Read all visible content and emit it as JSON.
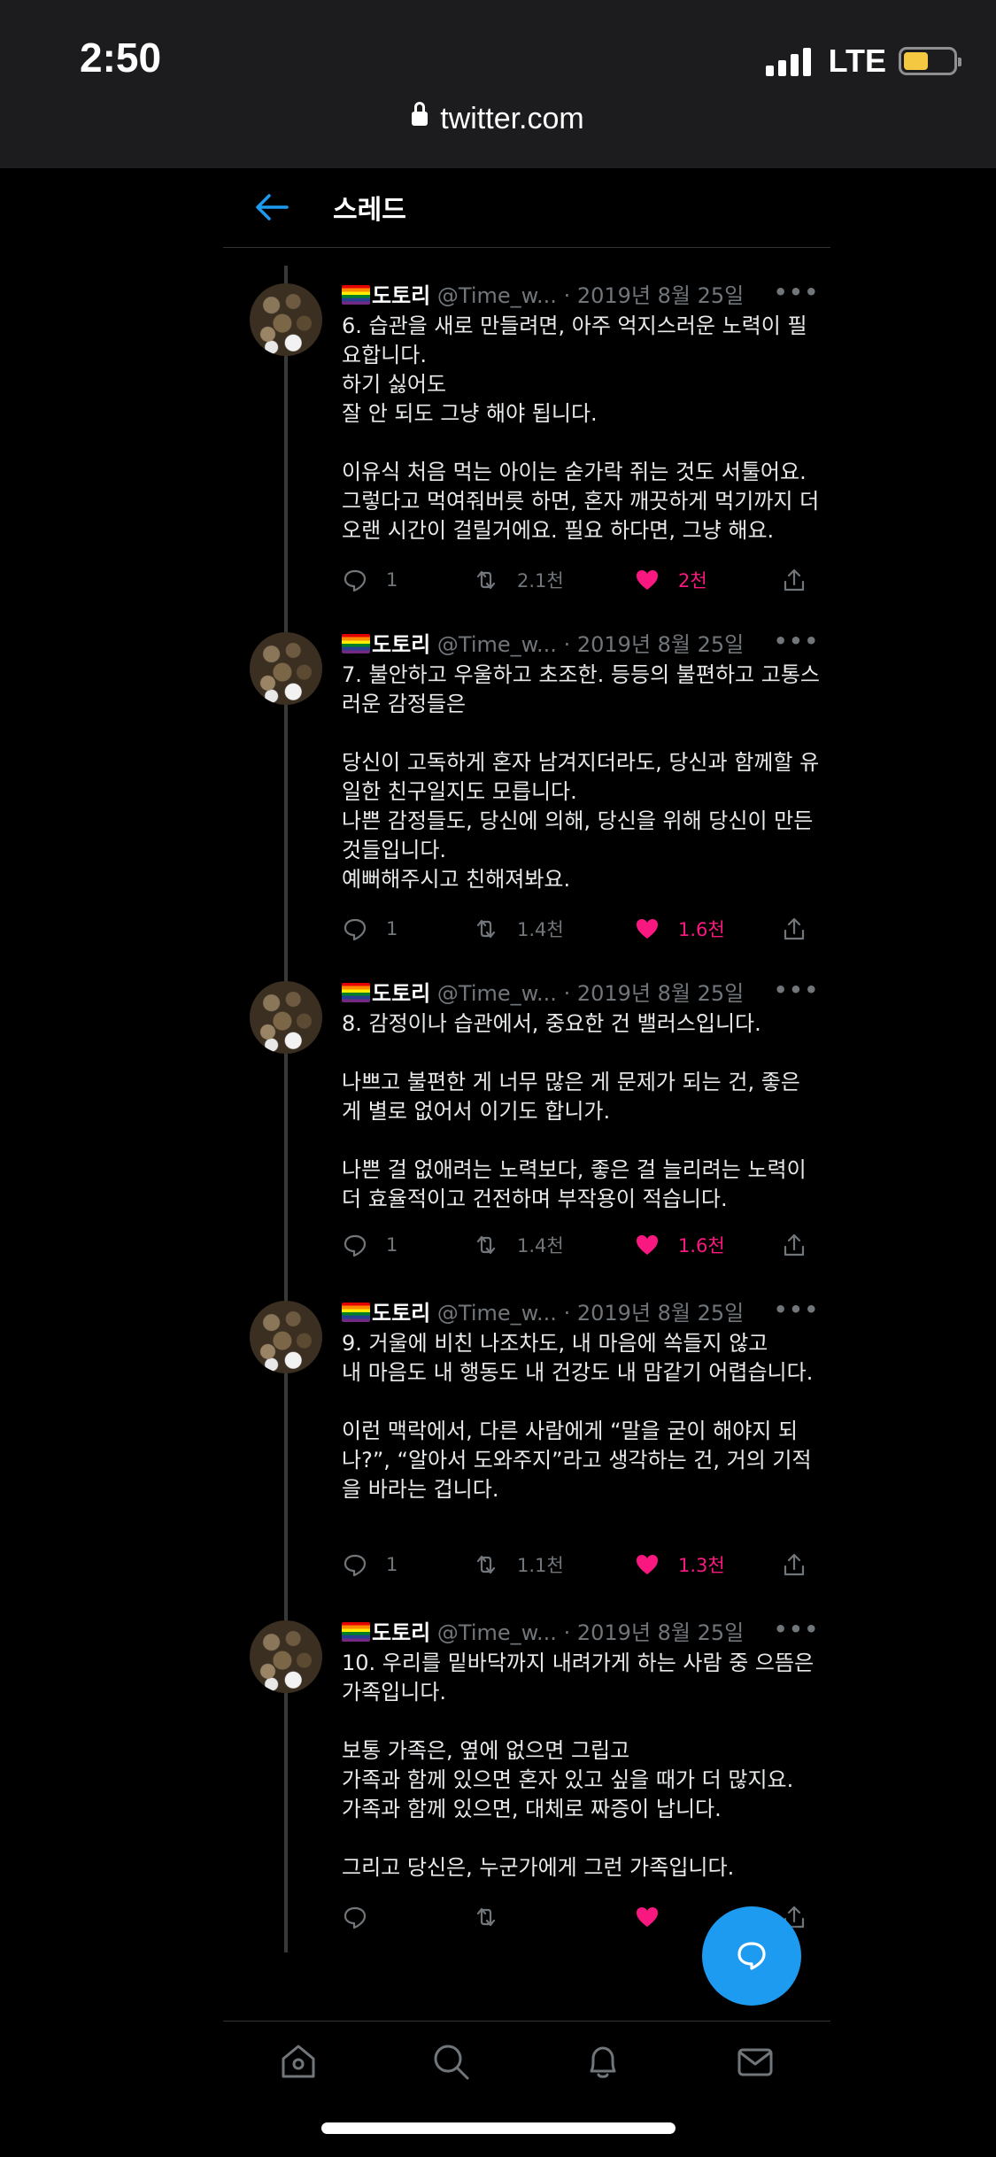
{
  "status_bar": {
    "time": "2:50",
    "network": "LTE",
    "battery_level": 0.5
  },
  "browser": {
    "url": "twitter.com"
  },
  "header": {
    "title": "스레드"
  },
  "tweets": [
    {
      "name": "도토리",
      "handle": "@Time_w...",
      "dot": "·",
      "date": "2019년 8월 25일",
      "text": "6. 습관을 새로 만들려면, 아주 억지스러운 노력이 필요합니다.\n하기 싫어도\n잘 안 되도 그냥 해야 됩니다.\n\n이유식 처음 먹는 아이는 숟가락 쥐는 것도 서툴어요.\n그렇다고 먹여줘버릇 하면, 혼자 깨끗하게 먹기까지 더 오랜 시간이 걸릴거에요. 필요 하다면, 그냥 해요.",
      "replies": "1",
      "retweets": "2.1천",
      "likes": "2천"
    },
    {
      "name": "도토리",
      "handle": "@Time_w...",
      "dot": "·",
      "date": "2019년 8월 25일",
      "text": "7. 불안하고 우울하고 초조한. 등등의 불편하고 고통스러운 감정들은\n\n당신이 고독하게 혼자 남겨지더라도, 당신과 함께할 유일한 친구일지도 모릅니다.\n나쁜 감정들도, 당신에 의해, 당신을 위해 당신이 만든 것들입니다.\n예뻐해주시고 친해져봐요.",
      "replies": "1",
      "retweets": "1.4천",
      "likes": "1.6천"
    },
    {
      "name": "도토리",
      "handle": "@Time_w...",
      "dot": "·",
      "date": "2019년 8월 25일",
      "text": "8. 감정이나 습관에서, 중요한 건 밸러스입니다.\n\n나쁘고 불편한 게 너무 많은 게 문제가 되는 건, 좋은 게 별로 없어서 이기도 합니가.\n\n나쁜 걸 없애려는 노력보다, 좋은 걸 늘리려는 노력이 더 효율적이고 건전하며 부작용이 적습니다.",
      "replies": "1",
      "retweets": "1.4천",
      "likes": "1.6천"
    },
    {
      "name": "도토리",
      "handle": "@Time_w...",
      "dot": "·",
      "date": "2019년 8월 25일",
      "text": "9. 거울에 비친 나조차도, 내 마음에 쏙들지 않고\n내 마음도 내 행동도 내 건강도 내 맘같기 어렵습니다.\n\n이런 맥락에서, 다른 사람에게 “말을 굳이 해야지 되나?”, “알아서 도와주지”라고 생각하는 건, 거의 기적을 바라는 겁니다.",
      "replies": "1",
      "retweets": "1.1천",
      "likes": "1.3천"
    },
    {
      "name": "도토리",
      "handle": "@Time_w...",
      "dot": "·",
      "date": "2019년 8월 25일",
      "text": "10. 우리를 밑바닥까지 내려가게 하는 사람 중 으뜸은 가족입니다.\n\n보통 가족은, 옆에 없으면 그립고\n가족과 함께 있으면 혼자 있고 싶을 때가 더 많지요.\n가족과 함께 있으면, 대체로 짜증이 납니다.\n\n그리고 당신은, 누군가에게 그런 가족입니다.",
      "replies": "",
      "retweets": "",
      "likes": ""
    }
  ],
  "colors": {
    "background": "#000000",
    "accent": "#1d9bf0",
    "like": "#f91880",
    "muted": "#71767b"
  },
  "icons": [
    "back-arrow-icon",
    "reply-icon",
    "retweet-icon",
    "like-icon",
    "share-icon",
    "compose-icon",
    "home-icon",
    "search-icon",
    "notifications-icon",
    "messages-icon"
  ]
}
